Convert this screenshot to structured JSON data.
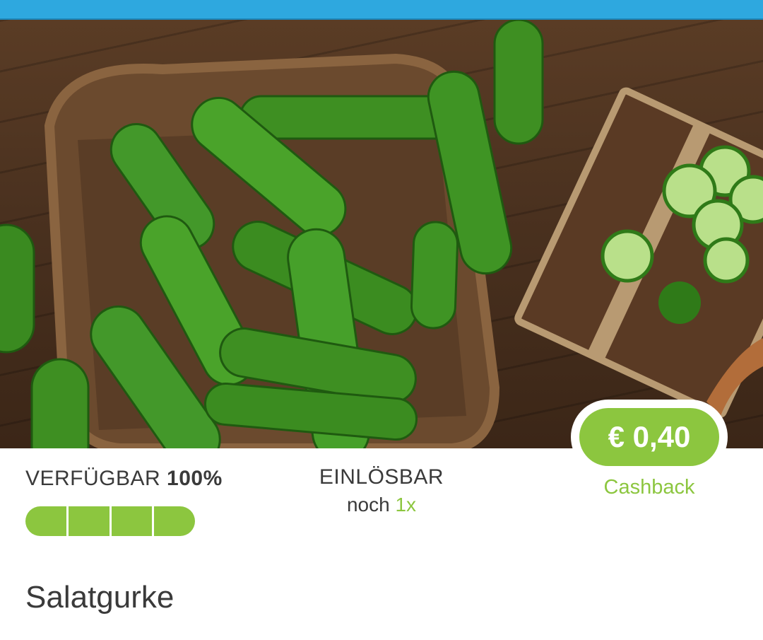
{
  "header": {
    "color": "#2ea8df"
  },
  "hero": {
    "image_icon": "cucumber-photo"
  },
  "cashback": {
    "amount": "€ 0,40",
    "label": "Cashback",
    "color": "#8cc63f"
  },
  "availability": {
    "label": "VERFÜGBAR",
    "percent": "100%",
    "segments_filled": 4,
    "segments_total": 4
  },
  "redeem": {
    "title": "EINLÖSBAR",
    "prefix": "noch ",
    "count": "1x"
  },
  "product": {
    "title": "Salatgurke"
  }
}
